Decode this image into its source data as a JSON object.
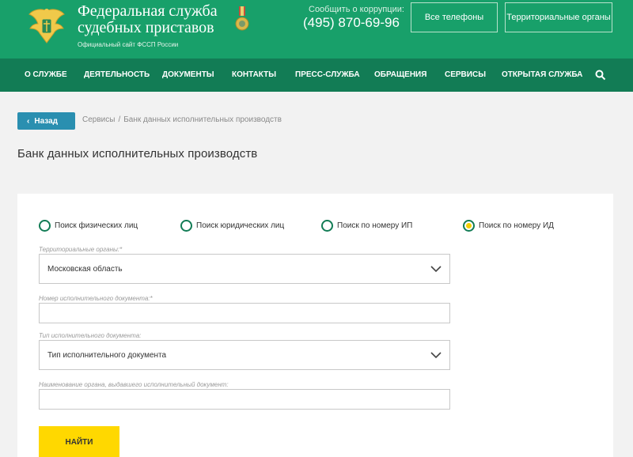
{
  "header": {
    "org_name_line1": "Федеральная служба",
    "org_name_line2": "судебных приставов",
    "org_sub": "Официальный сайт ФССП России",
    "corruption_label": "Сообщить о коррупции:",
    "phone": "(495) 870-69-96",
    "btn_phones": "Все телефоны",
    "btn_territorial": "Территориальные органы",
    "brand_color": "#18a06a"
  },
  "nav": {
    "items": [
      "О СЛУЖБЕ",
      "ДЕЯТЕЛЬНОСТЬ",
      "ДОКУМЕНТЫ",
      "КОНТАКТЫ",
      "ПРЕСС-СЛУЖБА",
      "ОБРАЩЕНИЯ",
      "СЕРВИСЫ",
      "ОТКРЫТАЯ СЛУЖБА"
    ],
    "search_icon": "search-icon",
    "bg_color": "#127c55"
  },
  "breadcrumb": {
    "back_label": "Назад",
    "items": [
      "Сервисы",
      "Банк данных исполнительных производств"
    ]
  },
  "page": {
    "title": "Банк данных исполнительных производств"
  },
  "form": {
    "radios": [
      {
        "label": "Поиск физических лиц",
        "checked": false
      },
      {
        "label": "Поиск юридических лиц",
        "checked": false
      },
      {
        "label": "Поиск по номеру ИП",
        "checked": false
      },
      {
        "label": "Поиск по номеру ИД",
        "checked": true
      }
    ],
    "territorial_label": "Территориальные органы:*",
    "territorial_value": "Московская область",
    "doc_number_label": "Номер исполнительного документа:*",
    "doc_number_value": "",
    "doc_type_label": "Тип исполнительного документа:",
    "doc_type_value": "Тип исполнительного документа",
    "issuer_label": "Наименование органа, выдавшего исполнительный документ:",
    "issuer_value": "",
    "submit_label": "НАЙТИ",
    "submit_color": "#ffd800"
  }
}
